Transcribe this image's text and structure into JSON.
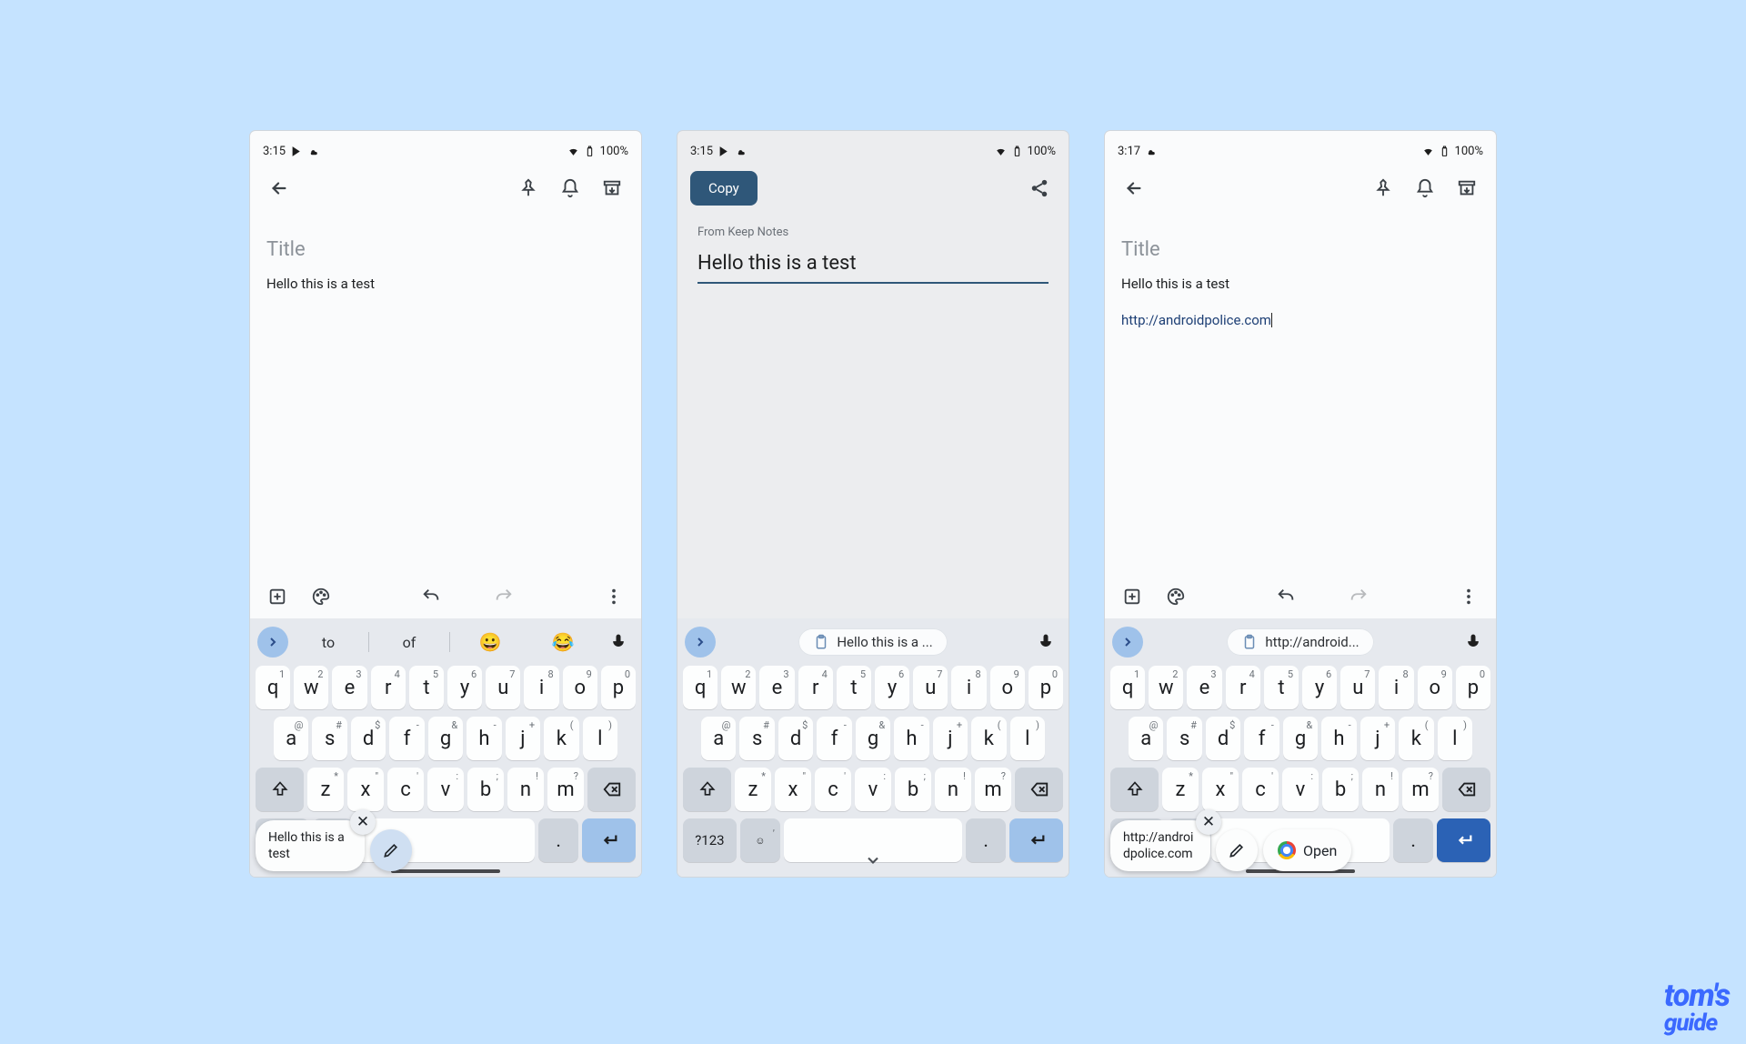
{
  "watermark": {
    "line1": "tom's",
    "line2": "guide"
  },
  "status_icons": {
    "wifi": "wifi-icon",
    "battery_outline": "battery-icon"
  },
  "keyboard": {
    "row1": [
      {
        "k": "q",
        "h": "1"
      },
      {
        "k": "w",
        "h": "2"
      },
      {
        "k": "e",
        "h": "3"
      },
      {
        "k": "r",
        "h": "4"
      },
      {
        "k": "t",
        "h": "5"
      },
      {
        "k": "y",
        "h": "6"
      },
      {
        "k": "u",
        "h": "7"
      },
      {
        "k": "i",
        "h": "8"
      },
      {
        "k": "o",
        "h": "9"
      },
      {
        "k": "p",
        "h": "0"
      }
    ],
    "row2": [
      {
        "k": "a",
        "h": "@"
      },
      {
        "k": "s",
        "h": "#"
      },
      {
        "k": "d",
        "h": "$"
      },
      {
        "k": "f",
        "h": "-"
      },
      {
        "k": "g",
        "h": "&"
      },
      {
        "k": "h",
        "h": "-"
      },
      {
        "k": "j",
        "h": "+"
      },
      {
        "k": "k",
        "h": "("
      },
      {
        "k": "l",
        "h": ")"
      }
    ],
    "row3": [
      {
        "k": "z",
        "h": "*"
      },
      {
        "k": "x",
        "h": "''"
      },
      {
        "k": "c",
        "h": "'"
      },
      {
        "k": "v",
        "h": ":"
      },
      {
        "k": "b",
        "h": ";"
      },
      {
        "k": "n",
        "h": "!"
      },
      {
        "k": "m",
        "h": "?"
      }
    ],
    "num_label": "?123",
    "period": "."
  },
  "phones": [
    {
      "time": "3:15",
      "battery": "100%",
      "title_placeholder": "Title",
      "note_body": "Hello this is a test",
      "suggestions": {
        "word1": "to",
        "word2": "of",
        "emoji1": "😀",
        "emoji2": "😂"
      },
      "bubble_text": "Hello this is a test"
    },
    {
      "time": "3:15",
      "battery": "100%",
      "copy_label": "Copy",
      "from_label": "From Keep Notes",
      "big_text": "Hello this is a test",
      "clip_suggestion": "Hello this is a ..."
    },
    {
      "time": "3:17",
      "battery": "100%",
      "title_placeholder": "Title",
      "note_body": "Hello this is a test",
      "url_text": "http://androidpolice.com",
      "clip_suggestion": "http://android...",
      "bubble_text": "http://androidpolice.com",
      "open_label": "Open"
    }
  ]
}
